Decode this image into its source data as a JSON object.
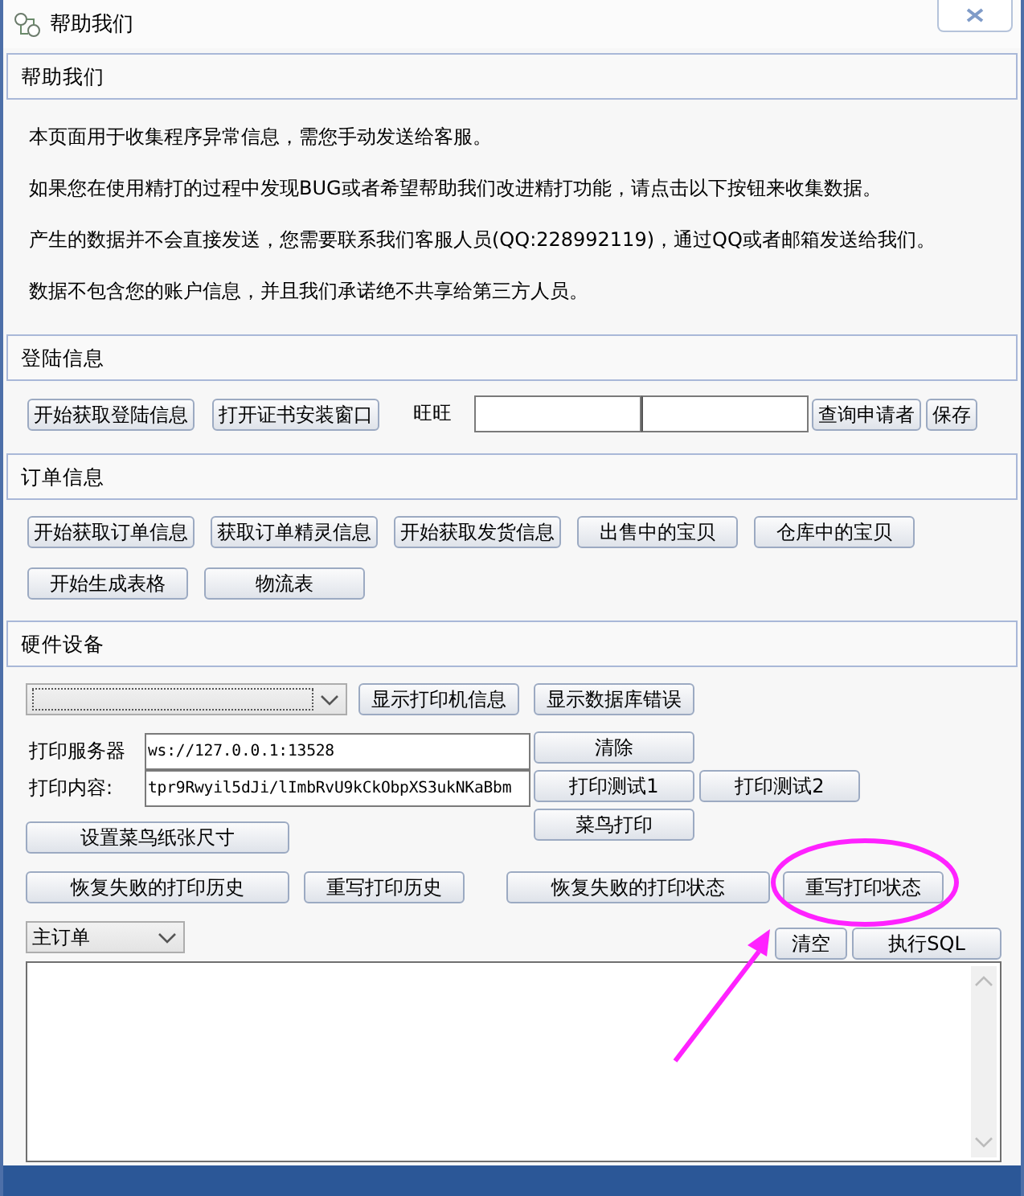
{
  "window": {
    "title": "帮助我们"
  },
  "help": {
    "title": "帮助我们",
    "paragraphs": [
      "本页面用于收集程序异常信息，需您手动发送给客服。",
      "如果您在使用精打的过程中发现BUG或者希望帮助我们改进精打功能，请点击以下按钮来收集数据。",
      "产生的数据并不会直接发送，您需要联系我们客服人员(QQ:228992119)，通过QQ或者邮箱发送给我们。",
      "数据不包含您的账户信息，并且我们承诺绝不共享给第三方人员。"
    ]
  },
  "login": {
    "title": "登陆信息",
    "buttons": [
      "开始获取登陆信息",
      "打开证书安装窗口"
    ],
    "wangwang_label": "旺旺",
    "lookup_button": "查询申请者",
    "save_button": "保存"
  },
  "orders": {
    "title": "订单信息",
    "rows": [
      [
        "开始获取订单信息",
        "获取订单精灵信息",
        "开始获取发货信息",
        "出售中的宝贝",
        "仓库中的宝贝"
      ],
      [
        "开始生成表格",
        "物流表"
      ]
    ]
  },
  "hardware": {
    "title": "硬件设备",
    "top_buttons": [
      "显示打印机信息",
      "显示数据库错误"
    ],
    "server_label": "打印服务器",
    "server_value": "ws://127.0.0.1:13528",
    "content_label": "打印内容:",
    "content_value": "tpr9Rwyil5dJi/lImbRvU9kCkObpXS3ukNKaBbm",
    "clear_button": "清除",
    "test_buttons": [
      "打印测试1",
      "打印测试2"
    ],
    "cainiao_button": "菜鸟打印",
    "paper_button": "设置菜鸟纸张尺寸",
    "history_buttons": [
      "恢复失败的打印历史",
      "重写打印历史",
      "恢复失败的打印状态",
      "重写打印状态"
    ],
    "table_select": "主订单",
    "empty_button": "清空",
    "sql_button": "执行SQL"
  }
}
